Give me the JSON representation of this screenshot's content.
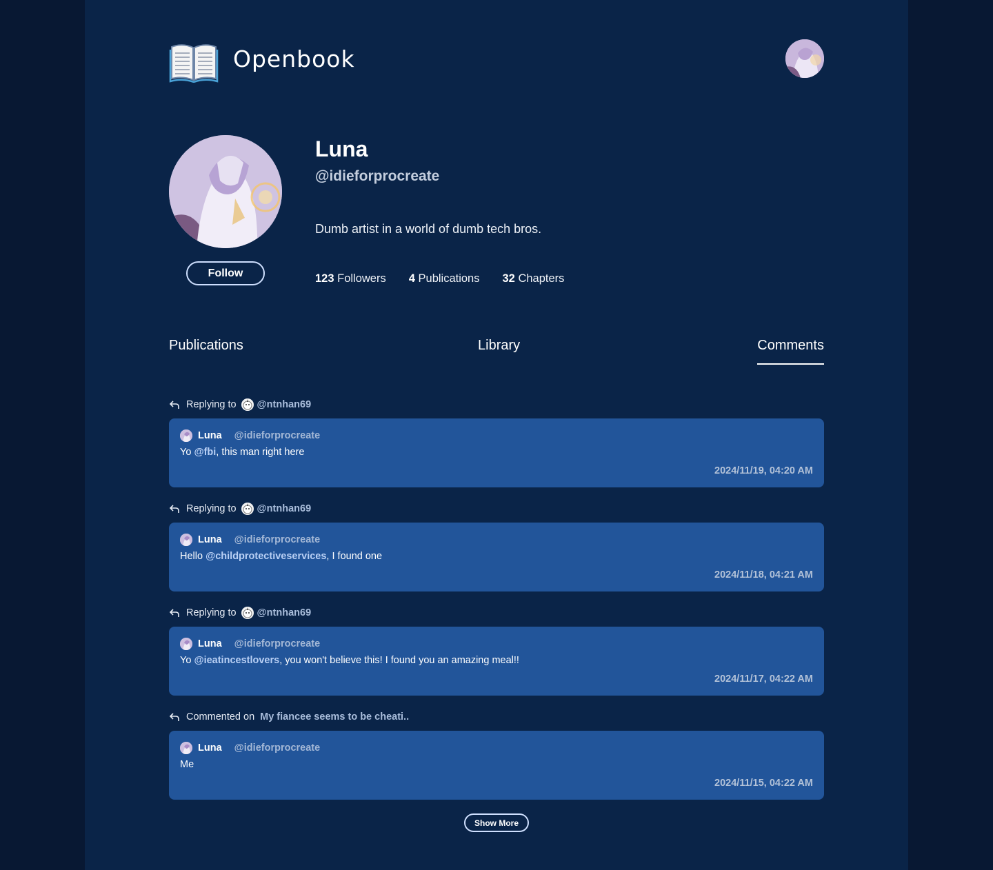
{
  "app": {
    "brand": "Openbook",
    "logo_icon": "open-book-icon"
  },
  "profile": {
    "name": "Luna",
    "handle": "@idieforprocreate",
    "bio": "Dumb artist in a world of dumb tech bros.",
    "follow_label": "Follow",
    "stats": [
      {
        "value": "123",
        "label": "Followers"
      },
      {
        "value": "4",
        "label": "Publications"
      },
      {
        "value": "32",
        "label": "Chapters"
      }
    ]
  },
  "tabs": [
    {
      "label": "Publications",
      "active": false
    },
    {
      "label": "Library",
      "active": false
    },
    {
      "label": "Comments",
      "active": true
    }
  ],
  "comments": [
    {
      "context_label": "Replying to",
      "target": "@ntnhan69",
      "author_name": "Luna",
      "author_handle": "@idieforprocreate",
      "text_before": "Yo ",
      "mention": "@fbi",
      "text_after": ", this man right here",
      "timestamp": "2024/11/19, 04:20 AM"
    },
    {
      "context_label": "Replying to",
      "target": "@ntnhan69",
      "author_name": "Luna",
      "author_handle": "@idieforprocreate",
      "text_before": "Hello ",
      "mention": "@childprotectiveservices",
      "text_after": ", I found one",
      "timestamp": "2024/11/18, 04:21 AM"
    },
    {
      "context_label": "Replying to",
      "target": "@ntnhan69",
      "author_name": "Luna",
      "author_handle": "@idieforprocreate",
      "text_before": "Yo ",
      "mention": "@ieatincestlovers",
      "text_after": ", you won't believe this! I found you an amazing meal!!",
      "timestamp": "2024/11/17, 04:22 AM"
    },
    {
      "context_label": "Commented on",
      "target": "My fiancee seems to be cheati..",
      "author_name": "Luna",
      "author_handle": "@idieforprocreate",
      "text_before": "Me",
      "mention": "",
      "text_after": "",
      "timestamp": "2024/11/15, 04:22 AM"
    }
  ],
  "show_more_label": "Show More",
  "colors": {
    "outer_bg": "#081833",
    "page_bg": "#0a2448",
    "card_bg": "#22559a",
    "handle_text": "#a4b8d6"
  }
}
